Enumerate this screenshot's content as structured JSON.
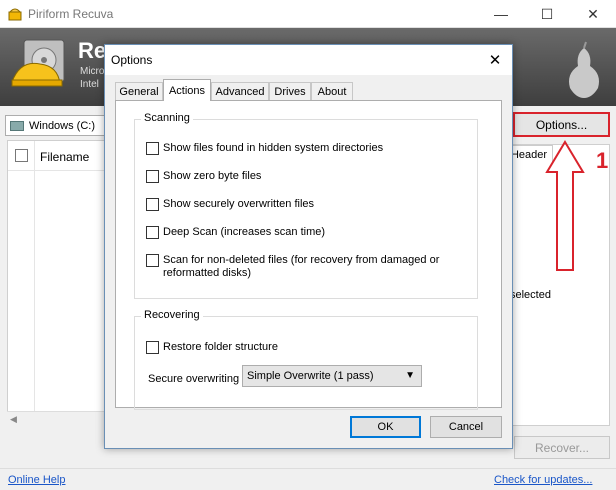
{
  "window": {
    "title": "Piriform Recuva",
    "minimize_glyph": "—",
    "maximize_glyph": "☐",
    "close_glyph": "✕"
  },
  "header": {
    "brand_name": "Rec",
    "brand_line1": "Micro",
    "brand_line2": "Intel"
  },
  "drive": {
    "label": "Windows (C:)"
  },
  "file_list": {
    "column_filename": "Filename"
  },
  "main_options_button": {
    "label": "Options..."
  },
  "right_panel": {
    "tab_label": "Header",
    "selected_text": "selected",
    "recover_label": "Recover..."
  },
  "footer": {
    "online_help": "Online Help",
    "check_updates": "Check for updates..."
  },
  "annotation": {
    "number": "1",
    "color": "#d9232c"
  },
  "dialog": {
    "title": "Options",
    "close_glyph": "✕",
    "tabs": [
      {
        "label": "General",
        "active": false
      },
      {
        "label": "Actions",
        "active": true
      },
      {
        "label": "Advanced",
        "active": false
      },
      {
        "label": "Drives",
        "active": false
      },
      {
        "label": "About",
        "active": false
      }
    ],
    "scanning": {
      "legend": "Scanning",
      "options": [
        {
          "label": "Show files found in hidden system directories",
          "checked": false
        },
        {
          "label": "Show zero byte files",
          "checked": false
        },
        {
          "label": "Show securely overwritten files",
          "checked": false
        },
        {
          "label": "Deep Scan (increases scan time)",
          "checked": false
        },
        {
          "label": "Scan for non-deleted files (for recovery from damaged or reformatted disks)",
          "checked": false
        }
      ]
    },
    "recovering": {
      "legend": "Recovering",
      "restore_label": "Restore folder structure",
      "restore_checked": false,
      "secure_label": "Secure overwriting",
      "secure_value": "Simple Overwrite (1 pass)"
    },
    "ok_label": "OK",
    "cancel_label": "Cancel"
  },
  "colors": {
    "accent_focus": "#0078d7",
    "annotation_red": "#d9232c",
    "link": "#1a56c8"
  }
}
